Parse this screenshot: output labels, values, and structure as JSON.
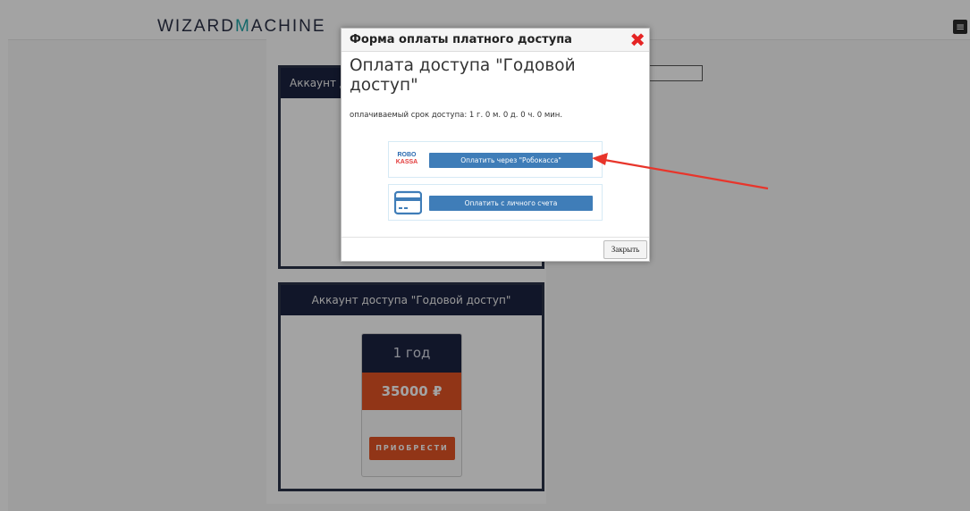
{
  "header": {
    "logo_part1": "WIZARD",
    "logo_part2": "M",
    "logo_part3": "ACHINE",
    "menu_icon": "menu-icon"
  },
  "cards": {
    "top_title": "Аккаунт доступа \"Годовой доступ\"",
    "bottom_title": "Аккаунт доступа \"Годовой доступ\"",
    "period": "1 год",
    "price": "35000 ₽",
    "buy_label": "ПРИОБРЕСТИ"
  },
  "modal": {
    "title": "Форма оплаты платного доступа",
    "close_icon": "✖",
    "heading": "Оплата доступа \"Годовой доступ\"",
    "term": "оплачиваемый срок доступа: 1 г. 0 м. 0 д. 0 ч. 0 мин.",
    "robokassa_logo_line1": "ROBO",
    "robokassa_logo_line2": "KASSA",
    "robokassa_button": "Оплатить через \"Робокасса\"",
    "account_button": "Оплатить с личного счета",
    "close_button": "Закрыть"
  },
  "colors": {
    "accent_dark": "#1c2340",
    "accent_orange": "#e35425",
    "pay_button": "#3f7db8",
    "annotation_arrow": "#e8352b"
  }
}
